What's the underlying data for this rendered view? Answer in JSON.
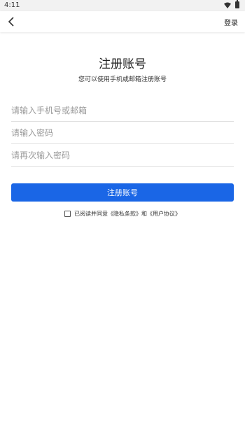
{
  "status_bar": {
    "time": "4:11"
  },
  "nav": {
    "login_label": "登录"
  },
  "header": {
    "title": "注册账号",
    "subtitle": "您可以使用手机或邮箱注册账号"
  },
  "form": {
    "account_placeholder": "请输入手机号或邮箱",
    "password_placeholder": "请输入密码",
    "confirm_placeholder": "请再次输入密码",
    "submit_label": "注册账号"
  },
  "agreement": {
    "prefix": "已阅读并同意",
    "privacy_link": "《隐私条款》",
    "joiner": "和",
    "user_link": "《用户协议》"
  },
  "colors": {
    "primary": "#1a66e6"
  }
}
